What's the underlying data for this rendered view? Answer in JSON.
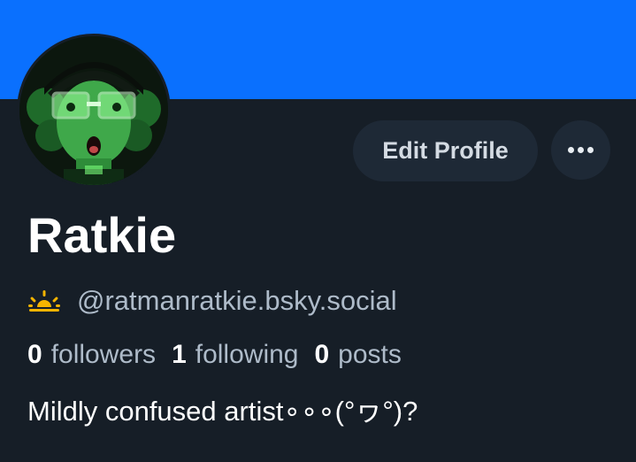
{
  "colors": {
    "banner": "#0a70fe",
    "background": "#161e27",
    "button_bg": "#1e2936",
    "muted_text": "#aebbc9",
    "sun_icon": "#f5b400"
  },
  "header": {
    "edit_profile_label": "Edit Profile",
    "more_icon": "ellipsis-icon"
  },
  "profile": {
    "display_name": "Ratkie",
    "status_icon": "sunrise-icon",
    "handle": "@ratmanratkie.bsky.social",
    "stats": {
      "followers_count": "0",
      "followers_label": "followers",
      "following_count": "1",
      "following_label": "following",
      "posts_count": "0",
      "posts_label": "posts"
    },
    "bio": "Mildly confused artist∘∘∘(°ヮ°)?"
  }
}
